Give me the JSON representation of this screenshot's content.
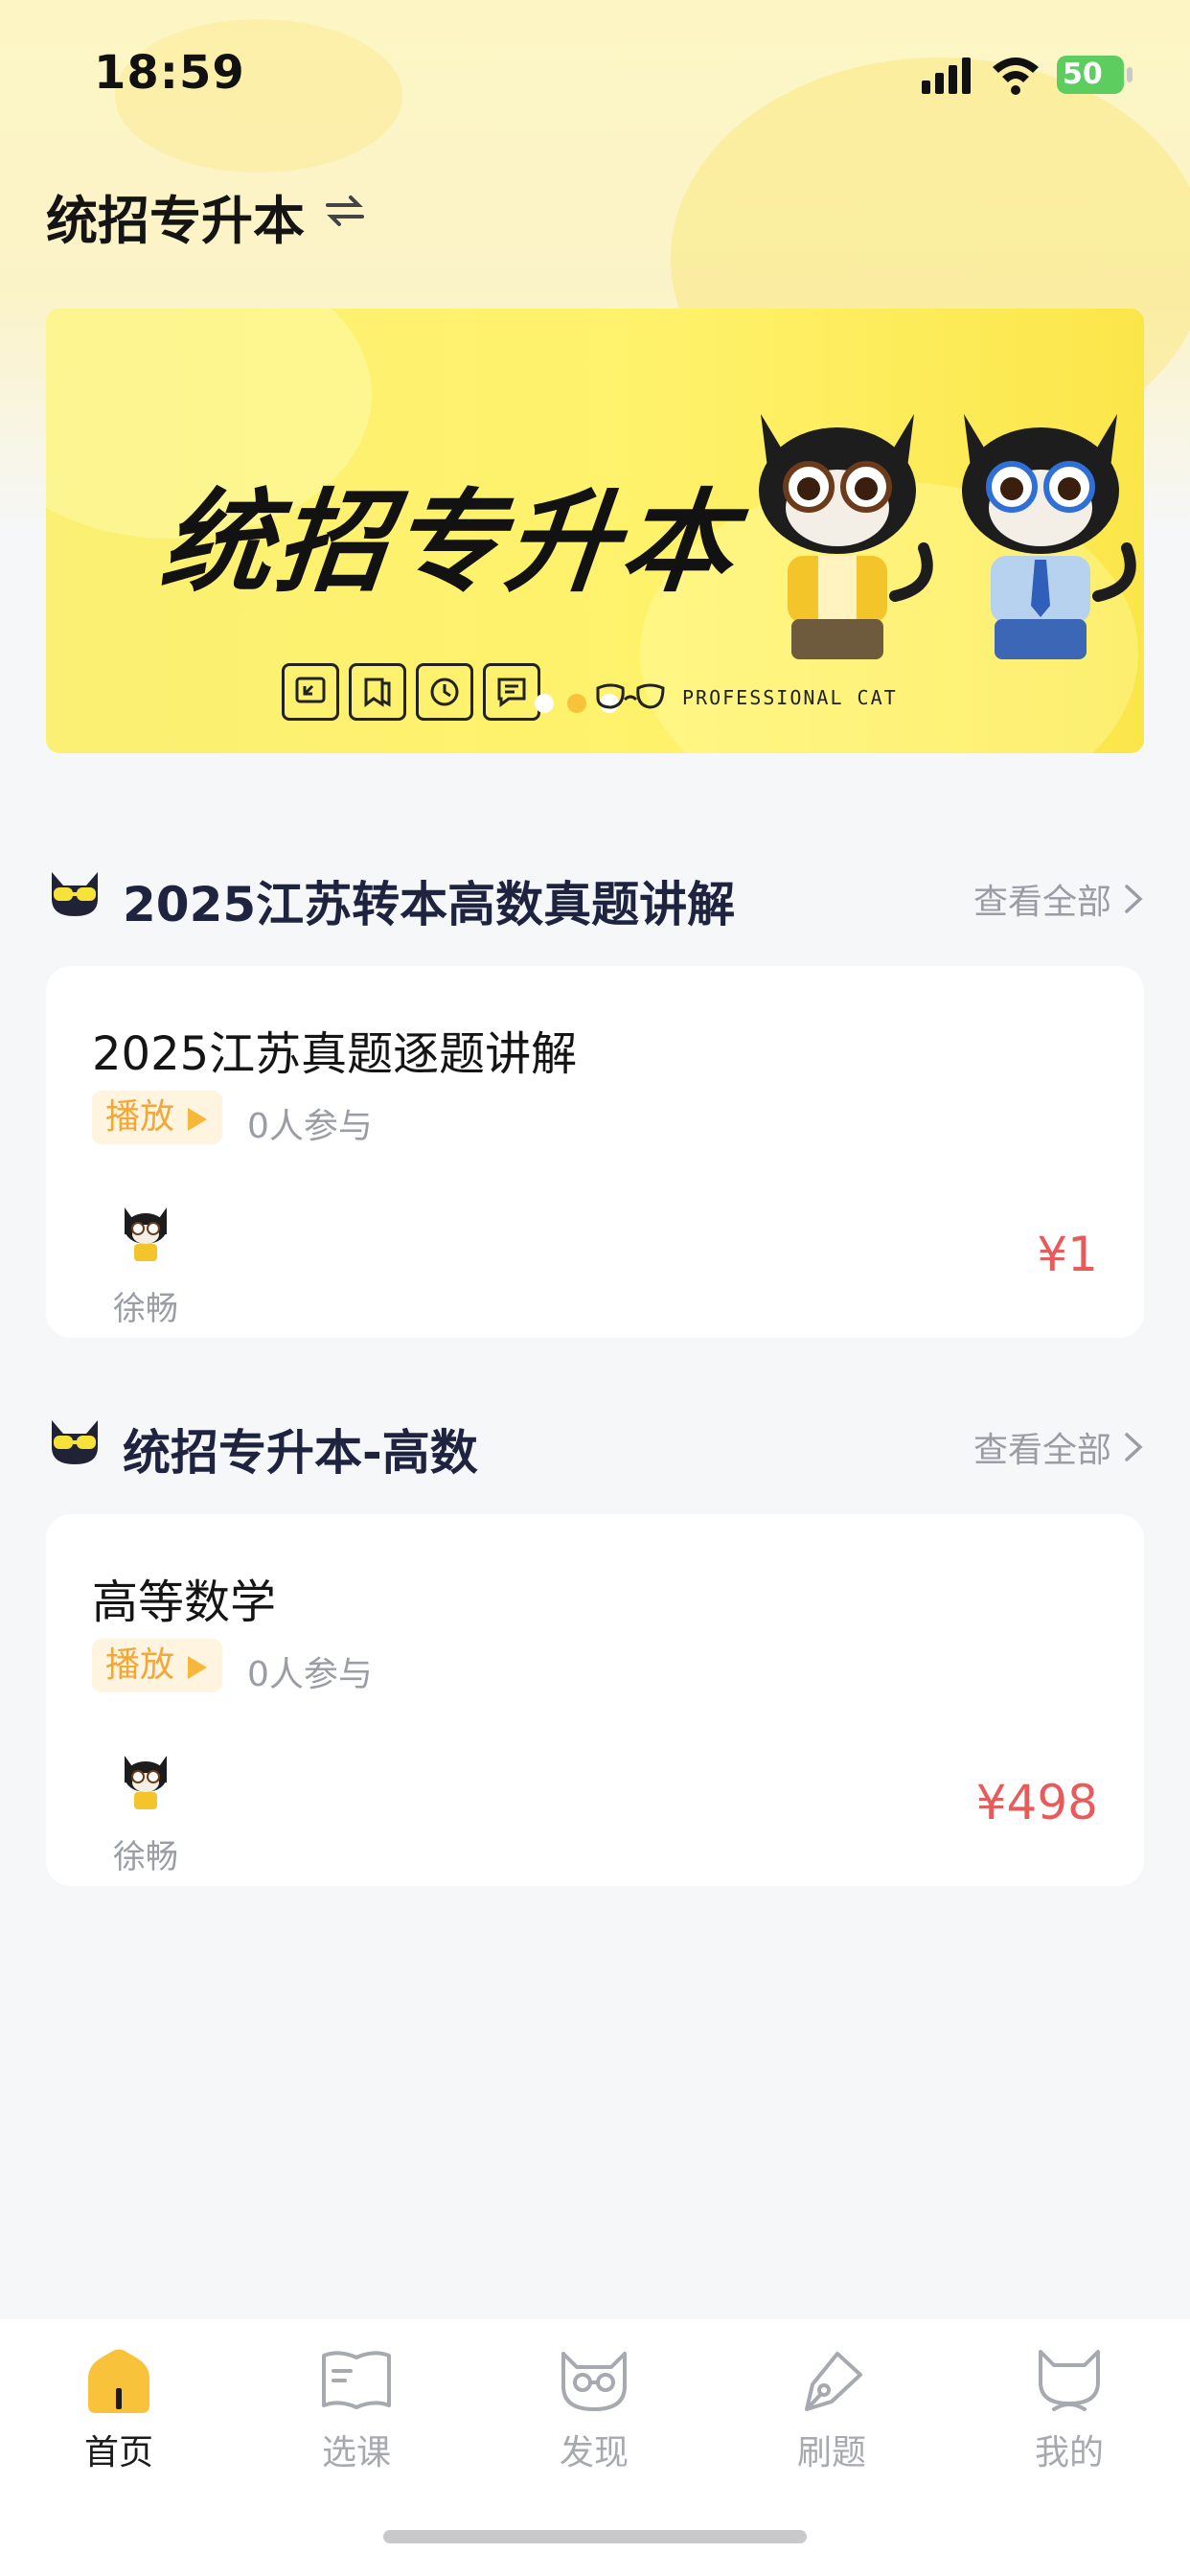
{
  "status_bar": {
    "time": "18:59",
    "battery": "50"
  },
  "header": {
    "title": "统招专升本"
  },
  "banner": {
    "title": "统招专升本",
    "brand": "PROFESSIONAL CAT",
    "icons": [
      "resize-icon",
      "bookmark-icon",
      "history-icon",
      "note-icon"
    ]
  },
  "sections": [
    {
      "title": "2025江苏转本高数真题讲解",
      "see_all": "查看全部",
      "course": {
        "title": "2025江苏真题逐题讲解",
        "tag": "播放",
        "participants": "0人参与",
        "teacher": "徐畅",
        "price": "¥1"
      }
    },
    {
      "title": "统招专升本-高数",
      "see_all": "查看全部",
      "course": {
        "title": "高等数学",
        "tag": "播放",
        "participants": "0人参与",
        "teacher": "徐畅",
        "price": "¥498"
      }
    }
  ],
  "tabs": [
    {
      "label": "首页",
      "icon": "home-icon",
      "active": true
    },
    {
      "label": "选课",
      "icon": "book-icon",
      "active": false
    },
    {
      "label": "发现",
      "icon": "cat-glasses-icon",
      "active": false
    },
    {
      "label": "刷题",
      "icon": "pen-icon",
      "active": false
    },
    {
      "label": "我的",
      "icon": "cat-profile-icon",
      "active": false
    }
  ],
  "colors": {
    "accent": "#f8c33a",
    "price": "#e85b5b",
    "banner": "#fff26b"
  }
}
